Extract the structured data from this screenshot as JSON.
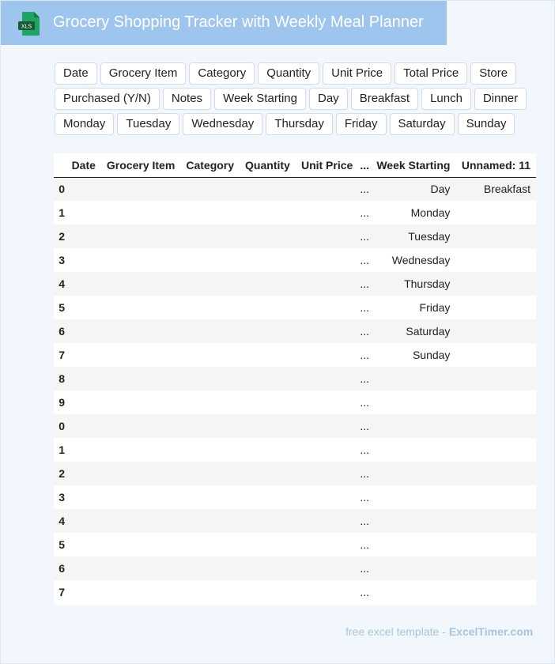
{
  "header": {
    "title": "Grocery Shopping Tracker with Weekly Meal Planner",
    "icon_label": "XLS"
  },
  "chips": [
    [
      "Date",
      "Grocery Item",
      "Category",
      "Quantity",
      "Unit Price",
      "Total Price",
      "Store"
    ],
    [
      "Purchased (Y/N)",
      "Notes",
      "Week Starting",
      "Day",
      "Breakfast",
      "Lunch",
      "Dinner"
    ],
    [
      "Monday",
      "Tuesday",
      "Wednesday",
      "Thursday",
      "Friday",
      "Saturday",
      "Sunday"
    ]
  ],
  "table": {
    "columns": [
      "",
      "Date",
      "Grocery Item",
      "Category",
      "Quantity",
      "Unit Price",
      "...",
      "Week Starting",
      "Unnamed: 11"
    ],
    "rows": [
      [
        "0",
        "",
        "",
        "",
        "",
        "",
        "...",
        "Day",
        "Breakfast"
      ],
      [
        "1",
        "",
        "",
        "",
        "",
        "",
        "...",
        "Monday",
        ""
      ],
      [
        "2",
        "",
        "",
        "",
        "",
        "",
        "...",
        "Tuesday",
        ""
      ],
      [
        "3",
        "",
        "",
        "",
        "",
        "",
        "...",
        "Wednesday",
        ""
      ],
      [
        "4",
        "",
        "",
        "",
        "",
        "",
        "...",
        "Thursday",
        ""
      ],
      [
        "5",
        "",
        "",
        "",
        "",
        "",
        "...",
        "Friday",
        ""
      ],
      [
        "6",
        "",
        "",
        "",
        "",
        "",
        "...",
        "Saturday",
        ""
      ],
      [
        "7",
        "",
        "",
        "",
        "",
        "",
        "...",
        "Sunday",
        ""
      ],
      [
        "8",
        "",
        "",
        "",
        "",
        "",
        "...",
        "",
        ""
      ],
      [
        "9",
        "",
        "",
        "",
        "",
        "",
        "...",
        "",
        ""
      ],
      [
        "0",
        "",
        "",
        "",
        "",
        "",
        "...",
        "",
        ""
      ],
      [
        "1",
        "",
        "",
        "",
        "",
        "",
        "...",
        "",
        ""
      ],
      [
        "2",
        "",
        "",
        "",
        "",
        "",
        "...",
        "",
        ""
      ],
      [
        "3",
        "",
        "",
        "",
        "",
        "",
        "...",
        "",
        ""
      ],
      [
        "4",
        "",
        "",
        "",
        "",
        "",
        "...",
        "",
        ""
      ],
      [
        "5",
        "",
        "",
        "",
        "",
        "",
        "...",
        "",
        ""
      ],
      [
        "6",
        "",
        "",
        "",
        "",
        "",
        "...",
        "",
        ""
      ],
      [
        "7",
        "",
        "",
        "",
        "",
        "",
        "...",
        "",
        ""
      ]
    ]
  },
  "footer": {
    "text": "free excel template -",
    "brand": "ExcelTimer.com"
  },
  "colors": {
    "header_bg": "#9ec5ee",
    "page_bg": "#f2f7fd",
    "icon_green": "#1e7145",
    "footer_text": "#a9c3df"
  }
}
